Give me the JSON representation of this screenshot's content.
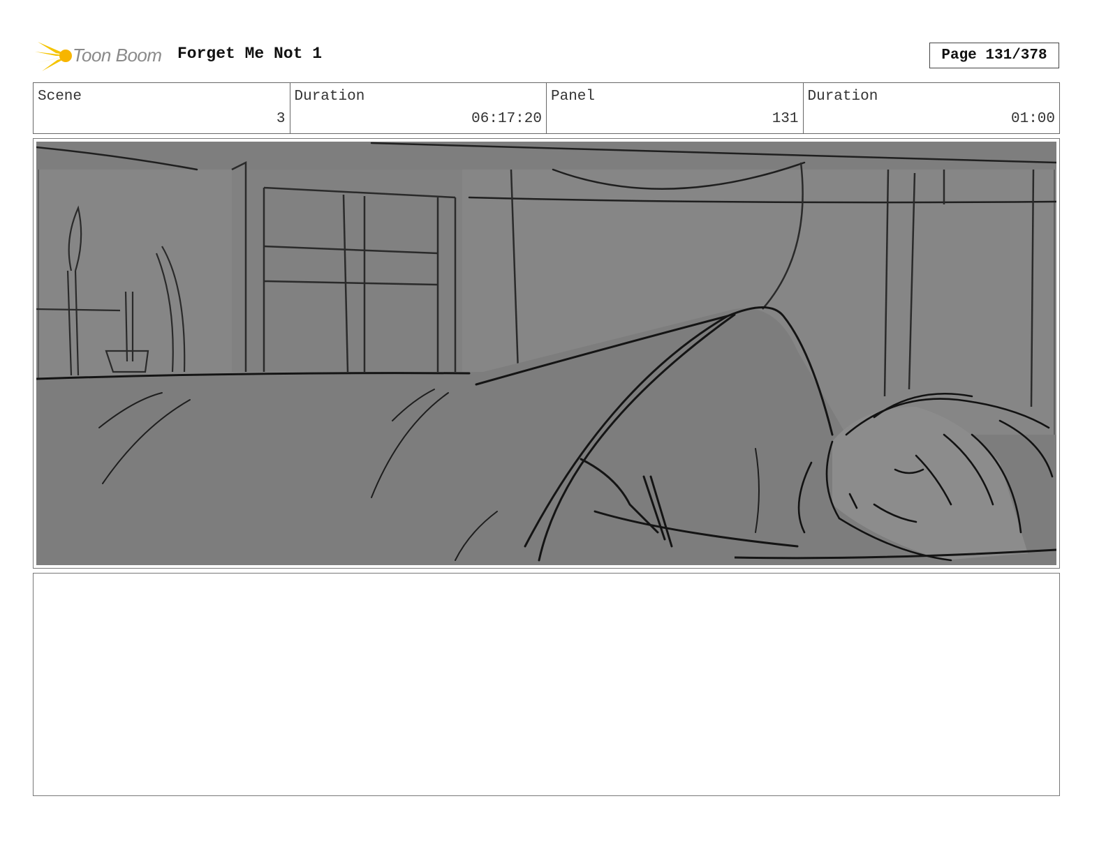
{
  "header": {
    "logo_text": "Toon Boom",
    "project_title": "Forget Me Not 1",
    "page_label": "Page 131/378"
  },
  "info": {
    "scene_label": "Scene",
    "scene_value": "3",
    "scene_duration_label": "Duration",
    "scene_duration_value": "06:17:20",
    "panel_label": "Panel",
    "panel_value": "131",
    "panel_duration_label": "Duration",
    "panel_duration_value": "01:00"
  },
  "colors": {
    "logo_star": "#f5c400",
    "panel_background": "#868686",
    "sketch_line": "#1a1a1a"
  },
  "notes": {
    "text": ""
  }
}
